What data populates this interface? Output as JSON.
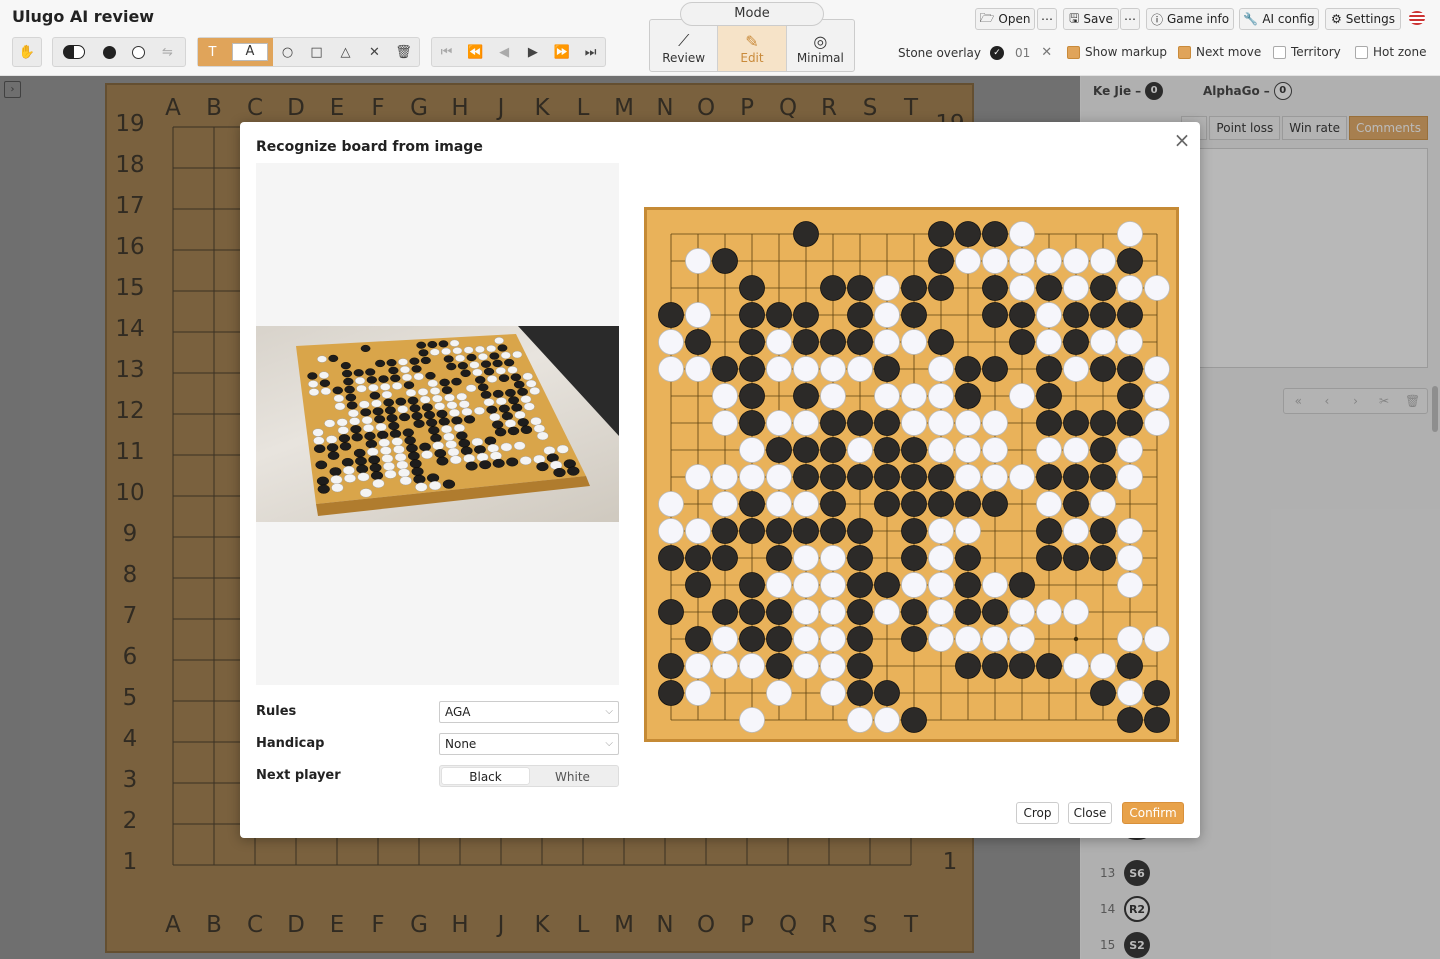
{
  "app": {
    "title": "Ulugo AI review"
  },
  "top_buttons": {
    "open": "Open",
    "more1": "⋯",
    "save": "Save",
    "more2": "⋯",
    "game_info": "Game info",
    "ai_config": "AI config",
    "settings": "Settings"
  },
  "mode": {
    "label": "Mode",
    "review": "Review",
    "edit": "Edit",
    "minimal": "Minimal",
    "active": "Edit"
  },
  "stone_overlay": {
    "label": "Stone overlay",
    "value": "01"
  },
  "toggles": {
    "show_markup": "Show markup",
    "next_move": "Next move",
    "territory": "Territory",
    "hot_zone": "Hot zone"
  },
  "toggle_state": {
    "show_markup": true,
    "next_move": true,
    "territory": false,
    "hot_zone": false
  },
  "players": {
    "black": "Ke Jie",
    "black_score": "0",
    "white": "AlphaGo",
    "white_score": "0"
  },
  "tabs": [
    "re",
    "Point loss",
    "Win rate",
    "Comments"
  ],
  "active_tab": "Comments",
  "board": {
    "columns": [
      "A",
      "B",
      "C",
      "D",
      "E",
      "F",
      "G",
      "H",
      "J",
      "K",
      "L",
      "M",
      "N",
      "O",
      "P",
      "Q",
      "R",
      "S",
      "T"
    ],
    "rows": [
      "19",
      "18",
      "17",
      "16",
      "15",
      "14",
      "13",
      "12",
      "11",
      "10",
      "9",
      "8",
      "7",
      "6",
      "5",
      "4",
      "3",
      "2",
      "1"
    ]
  },
  "moves": [
    {
      "num": "13",
      "label": "S6",
      "color": "black"
    },
    {
      "num": "14",
      "label": "R2",
      "color": "white"
    },
    {
      "num": "15",
      "label": "S2",
      "color": "black"
    }
  ],
  "modal": {
    "title": "Recognize board from image",
    "rules_label": "Rules",
    "rules_value": "AGA",
    "handicap_label": "Handicap",
    "handicap_value": "None",
    "next_player_label": "Next player",
    "next_player_options": [
      "Black",
      "White"
    ],
    "next_player_selected": "Black",
    "crop": "Crop",
    "close": "Close",
    "confirm": "Confirm"
  },
  "recognized_position": [
    ".....b....bbbw...w.",
    ".wb.......bwwwwwwb.",
    "...b..bbwbb.bwbwbww",
    "bw.bbb.bwb..bbwbbb.",
    "wb.bwbbbwwb..bwbww.",
    "wwbbwwwwb.wbb.bwbbw",
    "..wb.bw.wwwb.wb..bw",
    "..wbwwbbbwwww.bbbbw",
    "...wbbbwbbwww.wwbw.",
    ".wwwwbbbbbbwwwbbbw.",
    "w.wbwwb.bbbbb.wbw..",
    "wwbbbbbb.bww..bwbw.",
    "bbb.bwwb.bwb..bbbw.",
    ".b.bwwwbbwwbwb...w.",
    "b.bbbwwbwbwbbwww...",
    ".bwbbwwb.bwwww...ww",
    "bwwwbwwb...bbbbwwb.",
    "bw..w.wbb.......bwbw",
    "...w...wwb.......bbw"
  ]
}
